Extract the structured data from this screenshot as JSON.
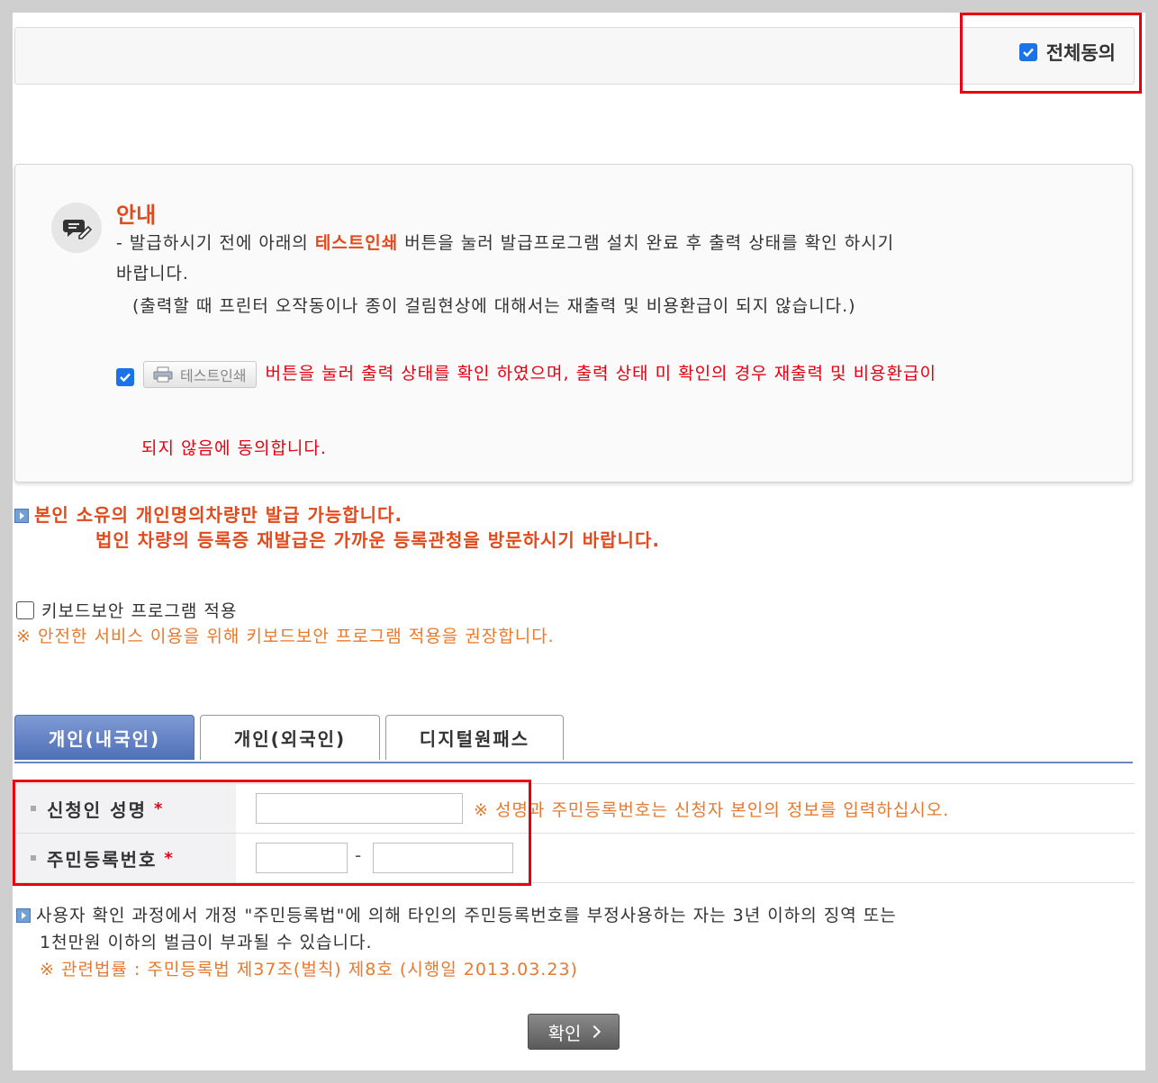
{
  "agree_all": {
    "label": "전체동의",
    "checked": true
  },
  "notice": {
    "title": "안내",
    "line1_prefix": "- 발급하시기 전에 아래의 ",
    "line1_highlight": "테스트인쇄",
    "line1_suffix": " 버튼을 눌러 발급프로그램 설치 완료 후 출력 상태를 확인 하시기",
    "line2": "바랍니다.",
    "line3": "(출력할 때 프린터 오작동이나 종이 걸림현상에 대해서는 재출력 및 비용환급이 되지 않습니다.)",
    "test_print_button": "테스트인쇄",
    "agree_text_1": "버튼을 눌러 출력 상태를 확인 하였으며, 출력 상태 미 확인의 경우 재출력 및 비용환급이",
    "agree_text_2": "되지 않음에 동의합니다.",
    "agree_checked": true
  },
  "own_vehicle_note": {
    "line1": "본인 소유의 개인명의차량만 발급 가능합니다.",
    "line2": "법인 차량의 등록증 재발급은 가까운 등록관청을 방문하시기 바랍니다."
  },
  "keyboard_security": {
    "label": "키보드보안 프로그램 적용",
    "checked": false,
    "note": "※ 안전한 서비스 이용을 위해 키보드보안 프로그램 적용을 권장합니다."
  },
  "tabs": [
    {
      "label": "개인(내국인)",
      "active": true
    },
    {
      "label": "개인(외국인)",
      "active": false
    },
    {
      "label": "디지털원패스",
      "active": false
    }
  ],
  "form": {
    "name_label": "신청인 성명",
    "rrn_label": "주민등록번호",
    "required_mark": "*",
    "hint": "※ 성명과 주민등록번호는 신청자 본인의 정보를 입력하십시오.",
    "name_value": "",
    "rrn_front_value": "",
    "rrn_back_value": "",
    "rrn_separator": "-"
  },
  "law_note": {
    "line1": "사용자 확인 과정에서 개정 \"주민등록법\"에 의해 타인의 주민등록번호를 부정사용하는 자는 3년 이하의 징역 또는",
    "line2": "1천만원 이하의 벌금이 부과될 수 있습니다.",
    "ref": "※ 관련법률 : 주민등록법 제37조(벌칙) 제8호 (시행일 2013.03.23)"
  },
  "confirm_button": "확인",
  "colors": {
    "accent_red": "#e60012",
    "accent_orange": "#e8792e",
    "tab_blue": "#4f6fb8",
    "checkbox_blue": "#1a73e8"
  }
}
